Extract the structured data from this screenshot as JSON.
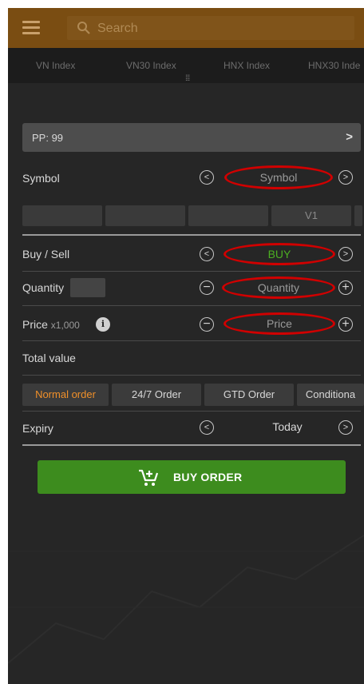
{
  "header": {
    "search_placeholder": "Search"
  },
  "index_tabs": [
    "VN Index",
    "VN30 Index",
    "HNX Index",
    "HNX30 Inde"
  ],
  "purchasing_power": {
    "label": "PP: 99",
    "chevron": ">"
  },
  "symbol_row": {
    "label": "Symbol",
    "value": "Symbol",
    "prev_glyph": "<",
    "next_glyph": ">"
  },
  "symbol_cells": [
    "",
    "",
    "",
    "V1",
    ""
  ],
  "side_row": {
    "label": "Buy / Sell",
    "value": "BUY",
    "prev_glyph": "<",
    "next_glyph": ">"
  },
  "quantity_row": {
    "label": "Quantity",
    "value": "Quantity",
    "minus_glyph": "−",
    "plus_glyph": "+"
  },
  "price_row": {
    "label": "Price",
    "unit": "x1,000",
    "info_glyph": "i",
    "value": "Price",
    "minus_glyph": "−",
    "plus_glyph": "+"
  },
  "total_value": {
    "label": "Total value"
  },
  "order_types": [
    "Normal order",
    "24/7 Order",
    "GTD Order",
    "Conditiona"
  ],
  "active_order_type": "Normal order",
  "expiry_row": {
    "label": "Expiry",
    "value": "Today",
    "prev_glyph": "<",
    "next_glyph": ">"
  },
  "submit": {
    "label": "BUY ORDER"
  },
  "colors": {
    "header_bg": "#7a4d12",
    "background": "#262626",
    "buy_green": "#4caf22",
    "button_green": "#3d8c1e",
    "active_tab": "#f0902a",
    "annotation_red": "#d00000"
  }
}
